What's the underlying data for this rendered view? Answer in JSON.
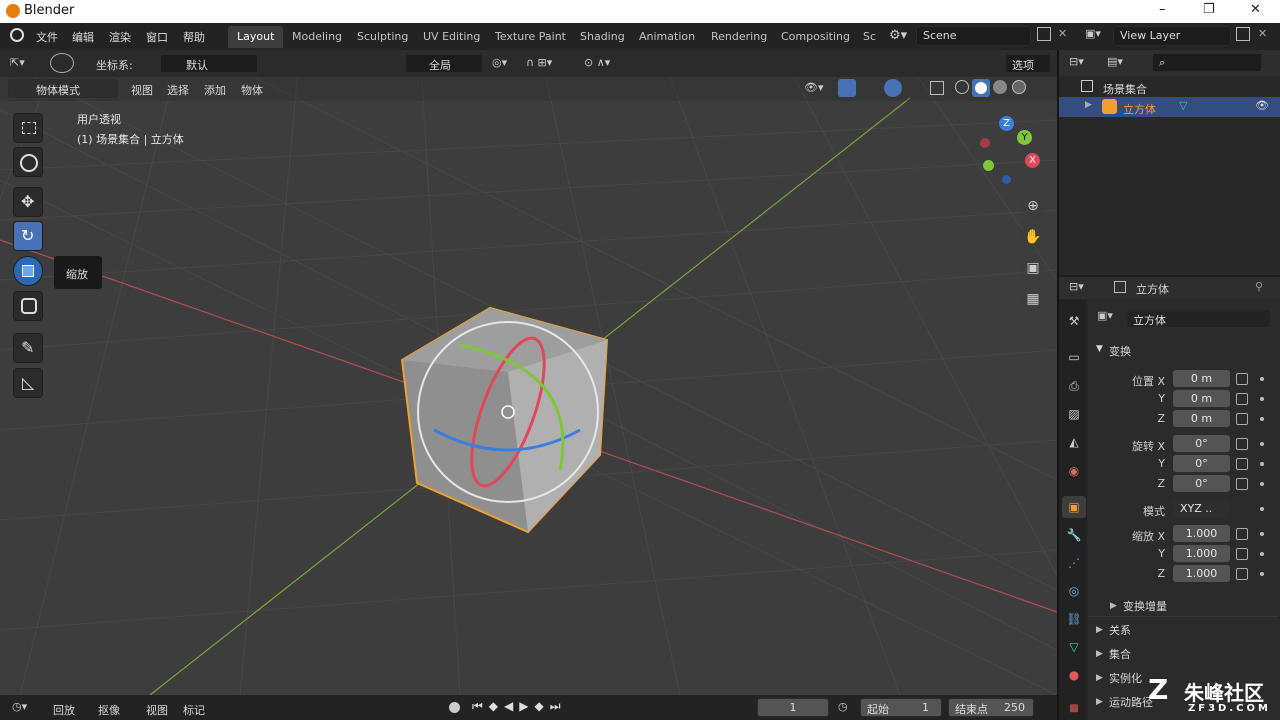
{
  "window": {
    "title": "Blender",
    "minimize": "–",
    "restore": "❐",
    "close": "✕"
  },
  "menus": [
    "文件",
    "编辑",
    "渲染",
    "窗口",
    "帮助"
  ],
  "workspaces": [
    "Layout",
    "Modeling",
    "Sculpting",
    "UV Editing",
    "Texture Paint",
    "Shading",
    "Animation",
    "Rendering",
    "Compositing",
    "Sc"
  ],
  "scene": {
    "name": "Scene",
    "view_layer": "View Layer"
  },
  "viewport_header": {
    "coord_label": "坐标系:",
    "coord_value": "默认",
    "pivot": "全局",
    "options": "选项",
    "mode": "物体模式",
    "menus": [
      "视图",
      "选择",
      "添加",
      "物体"
    ]
  },
  "viewport": {
    "view_name": "用户透视",
    "collection_info": "(1) 场景集合 | 立方体",
    "tooltip": "缩放",
    "gizmo": {
      "x": "X",
      "y": "Y",
      "z": "Z"
    }
  },
  "outliner": {
    "root": "场景集合",
    "object": "立方体"
  },
  "properties": {
    "object_name": "立方体",
    "data_name": "立方体",
    "transform_header": "变换",
    "location": {
      "label": "位置",
      "x": "0 m",
      "y": "0 m",
      "z": "0 m"
    },
    "rotation": {
      "label": "旋转",
      "x": "0°",
      "y": "0°",
      "z": "0°"
    },
    "mode": {
      "label": "模式",
      "value": "XYZ .."
    },
    "scale": {
      "label": "缩放",
      "x": "1.000",
      "y": "1.000",
      "z": "1.000"
    },
    "axis": {
      "x": "X",
      "y": "Y",
      "z": "Z"
    },
    "delta": "变换增量",
    "sections": [
      "关系",
      "集合",
      "实例化",
      "运动路径"
    ]
  },
  "timeline": {
    "playback": "回放",
    "keying": "抠像",
    "view": "视图",
    "marker": "标记",
    "current_frame": "1",
    "start_label": "起始",
    "start": "1",
    "end_label": "结束点",
    "end": "250"
  },
  "watermark": {
    "text": "朱峰社区",
    "url": "ZF3D.COM"
  },
  "colors": {
    "active_blue": "#4772b3",
    "selection_orange": "#f0a030",
    "x_axis": "#e0475a",
    "y_axis": "#7ec63a",
    "z_axis": "#3b7fdc"
  }
}
